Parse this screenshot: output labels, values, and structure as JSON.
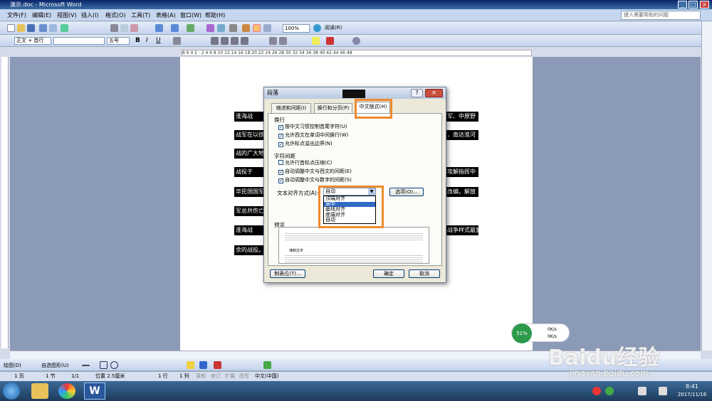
{
  "window": {
    "title": "演示.doc - Microsoft Word"
  },
  "menu": [
    "文件(F)",
    "编辑(E)",
    "视图(V)",
    "插入(I)",
    "格式(O)",
    "工具(T)",
    "表格(A)",
    "窗口(W)",
    "帮助(H)"
  ],
  "help_placeholder": "键入需要帮助的问题",
  "toolbar": {
    "zoom": "100%",
    "read": "阅读(R)"
  },
  "format_toolbar": {
    "style": "正文 + 首行",
    "size": "五号"
  },
  "ruler_text": "8  6  4  2  ·  2  4  6  8  10  12  14  16  18  20  22  24  26  28  30  32  34  36  38  40  42  44  46  48",
  "document": {
    "lines": [
      "淮海战",
      "战军在以徐",
      "战的广大地区",
      "战役于",
      "华民国国军",
      "军总共伤亡",
      "淮海战",
      "余的战役。"
    ],
    "right_lines": [
      "军、中原野",
      "，南达淮河",
      "攻解指挥中",
      "改编，解放",
      "战争样式最复"
    ]
  },
  "dialog": {
    "title": "段落",
    "tabs": [
      "缩进和间距(I)",
      "换行和分页(P)",
      "中文版式(H)"
    ],
    "group_wrap": "换行",
    "checkboxes_wrap": [
      "按中文习惯控制首尾字符(U)",
      "允许西文在单词中间换行(W)",
      "允许标点溢出边界(N)"
    ],
    "group_spacing": "字符间距",
    "checkboxes_spacing": [
      "允许行首标点压缩(C)",
      "自动调整中文与西文的间距(E)",
      "自动调整中文与数字的间距(S)"
    ],
    "align_label": "文本对齐方式(A):",
    "align_value": "自动",
    "options_button": "选项(O)...",
    "dropdown_options": [
      "顶端对齐",
      "居中",
      "基线对齐",
      "底端对齐",
      "自动"
    ],
    "preview_label": "预览",
    "preview_sample": "准制文字",
    "tabs_button": "制表位(T)...",
    "ok": "确定",
    "cancel": "取消"
  },
  "drawbar": {
    "draw": "绘图(D)",
    "autoshape": "自选图形(U)"
  },
  "status": {
    "page": "1 页",
    "section": "1 节",
    "pages": "1/1",
    "position": "位置 2.5厘米",
    "line": "1 行",
    "col": "1 列",
    "rec": "录制",
    "trk": "修订",
    "ext": "扩展",
    "ovr": "改写",
    "lang": "中文(中国)"
  },
  "network": {
    "cpu": "51%",
    "up": "0K/s",
    "down": "0K/s"
  },
  "watermark": {
    "brand": "Baidu经验",
    "url": "jingyan.baidu.com"
  },
  "tray": {
    "time": "8:41",
    "date": "2017/11/16"
  },
  "colors": {
    "highlight": "#f08a2e",
    "titlebar": "#0a246a",
    "selection": "#316ac5"
  }
}
